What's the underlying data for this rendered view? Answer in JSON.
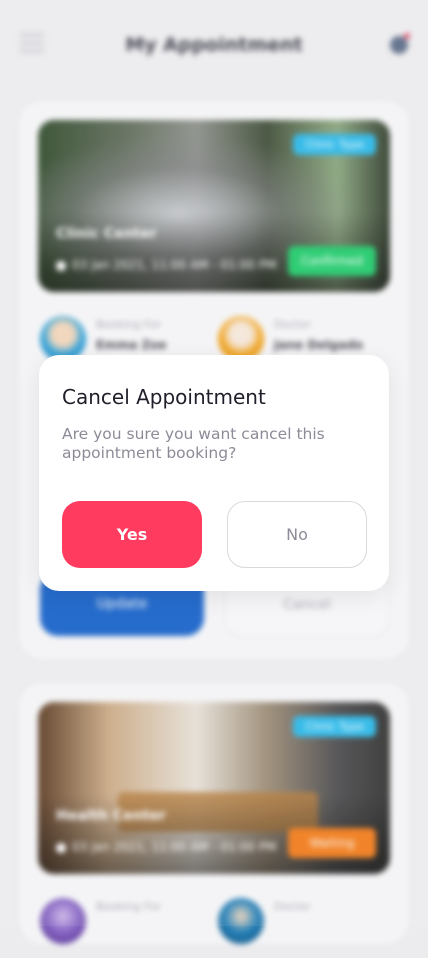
{
  "header": {
    "title": "My Appointment",
    "menu_icon": "menu-icon",
    "profile_icon": "profile-icon"
  },
  "appointments": [
    {
      "clinic_badge": "Clinic Type",
      "clinic_name": "Clinic Center",
      "datetime": "03 Jan 2021, 11:00 AM - 01:00 PM",
      "status": "Confirmed",
      "status_color": "#1fc96a",
      "booking_for_label": "Booking For",
      "booking_for_name": "Emma Zoe",
      "doctor_label": "Doctor",
      "doctor_name": "Jane Delgado",
      "update_label": "Update",
      "cancel_label": "Cancel"
    },
    {
      "clinic_badge": "Clinic Type",
      "clinic_name": "Health Center",
      "datetime": "03 Jan 2021, 11:00 AM - 01:00 PM",
      "status": "Waiting",
      "status_color": "#f07a18",
      "booking_for_label": "Booking For",
      "doctor_label": "Doctor"
    }
  ],
  "modal": {
    "title": "Cancel Appointment",
    "message": "Are you sure you want cancel this appointment booking?",
    "yes_label": "Yes",
    "no_label": "No",
    "accent": "#ff3b5f"
  }
}
